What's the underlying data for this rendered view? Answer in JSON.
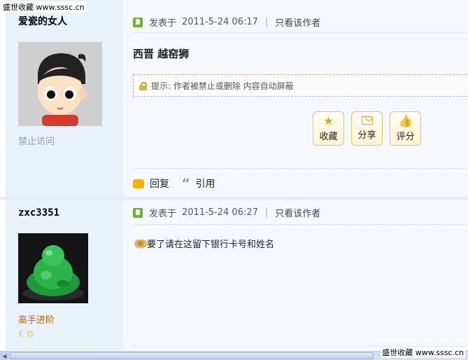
{
  "watermark_top": "盛世收藏 www.sssc.cn",
  "watermark_bottom": "盛世收藏 www.sssc.cn",
  "posts": [
    {
      "author": "爱瓷的女人",
      "user_status": "禁止访问",
      "posted_prefix": "发表于",
      "posted_time": "2011-5-24 06:17",
      "only_author": "只看该作者",
      "title": "西晋 越窑狮",
      "notice_text": "提示: 作者被禁止或删除 内容自动屏蔽",
      "buttons": [
        {
          "label": "收藏",
          "icon": "star-icon"
        },
        {
          "label": "分享",
          "icon": "share-icon"
        },
        {
          "label": "评分",
          "icon": "thumbs-up-icon"
        }
      ],
      "reply_label": "回复",
      "quote_label": "引用"
    },
    {
      "author": "zxc3351",
      "user_status": "高手进阶",
      "posted_prefix": "发表于",
      "posted_time": "2011-5-24 06:27",
      "only_author": "只看该作者",
      "message": "要了请在这留下银行卡号和姓名"
    }
  ],
  "colors": {
    "author_bg": "#e9f1f9",
    "content_bg": "#f5f9fd",
    "rank_text": "#e06000",
    "badge_green": "#6bb52c",
    "button_border": "#e3c46c"
  }
}
